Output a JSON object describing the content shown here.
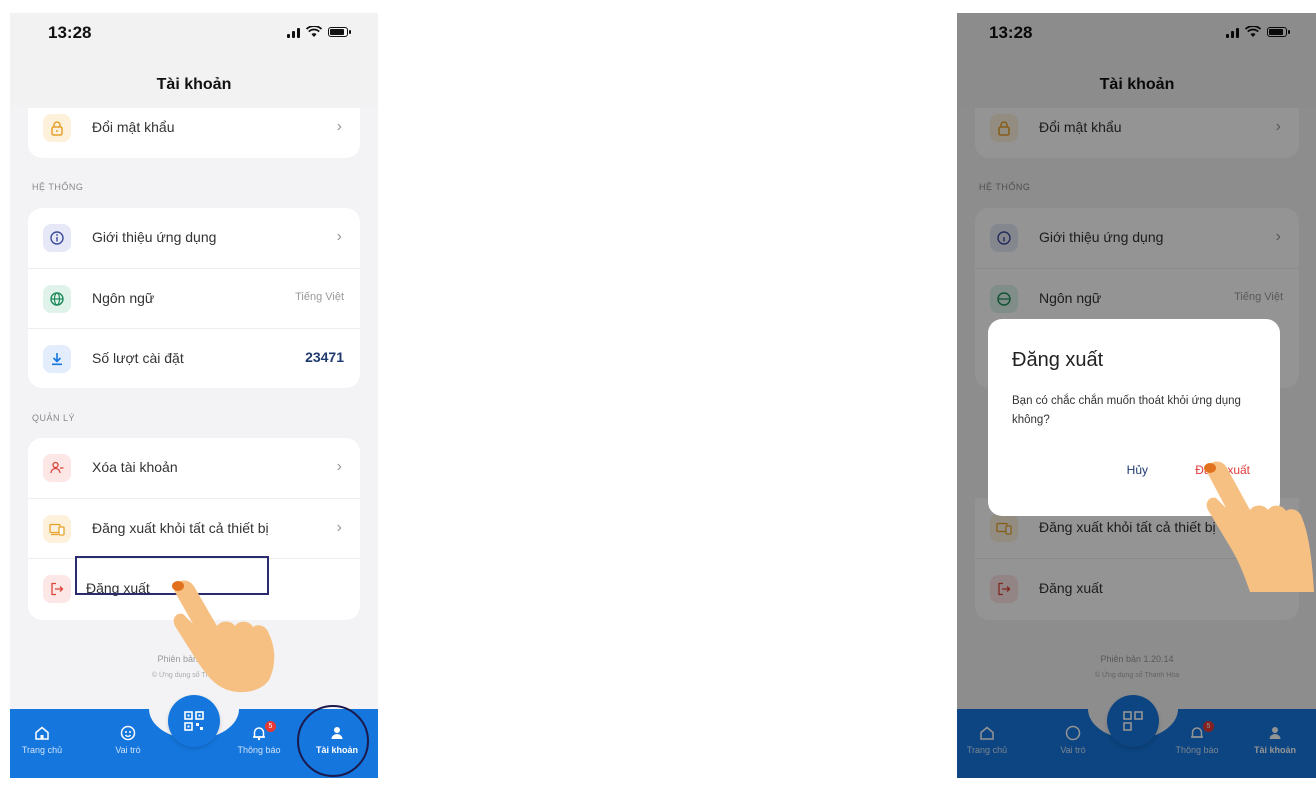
{
  "status": {
    "time": "13:28"
  },
  "header": {
    "title": "Tài khoản"
  },
  "account": {
    "change_password": "Đổi mật khẩu"
  },
  "system": {
    "section_label": "HỆ THỐNG",
    "about": "Giới thiệu ứng dụng",
    "language": "Ngôn ngữ",
    "language_value": "Tiếng Việt",
    "installs_label": "Số lượt cài đặt",
    "installs_count": "23471"
  },
  "manage": {
    "section_label": "QUẢN LÝ",
    "delete_account": "Xóa tài khoản",
    "logout_all": "Đăng xuất khỏi tất cả thiết bị",
    "logout": "Đăng xuất"
  },
  "footer": {
    "version": "Phiên bản 1.20.14",
    "copyright": "© Ứng dụng số Thanh Hóa"
  },
  "tabs": [
    {
      "label": "Trang chủ"
    },
    {
      "label": "Vai trò"
    },
    {
      "label": "Thông báo",
      "badge": "5"
    },
    {
      "label": "Tài khoản"
    }
  ],
  "dialog": {
    "title": "Đăng xuất",
    "message": "Bạn có chắc chắn muốn thoát khỏi ứng dụng không?",
    "cancel": "Hủy",
    "confirm": "Đăng xuất"
  },
  "colors": {
    "tabbar": "#1577de",
    "danger": "#e03a3a",
    "count": "#1f3a6e"
  },
  "icons": [
    "lock-icon",
    "info-icon",
    "globe-icon",
    "download-icon",
    "user-minus-icon",
    "devices-icon",
    "logout-icon",
    "home-icon",
    "role-icon",
    "qr-icon",
    "bell-icon",
    "user-icon",
    "pointing-hand-icon"
  ]
}
